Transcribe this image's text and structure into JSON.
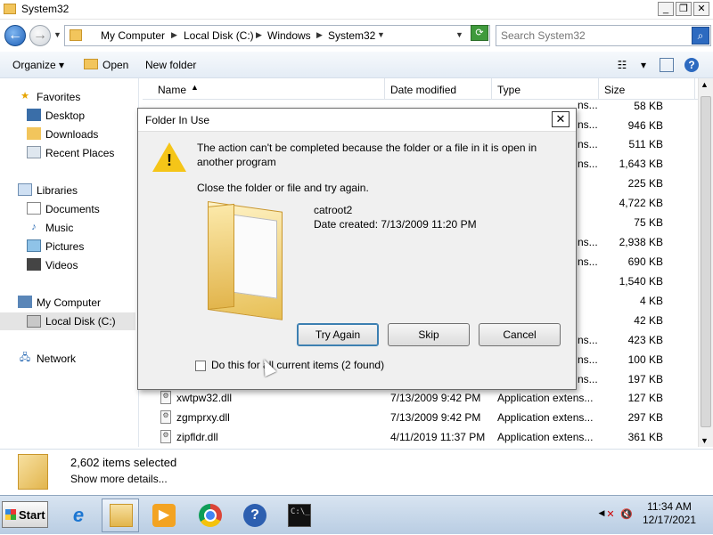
{
  "window": {
    "title": "System32"
  },
  "address": {
    "crumbs": [
      "My Computer",
      "Local Disk (C:)",
      "Windows",
      "System32"
    ],
    "search_placeholder": "Search System32"
  },
  "toolbar": {
    "organize": "Organize",
    "open": "Open",
    "new_folder": "New folder"
  },
  "nav": {
    "favorites": "Favorites",
    "desktop": "Desktop",
    "downloads": "Downloads",
    "recent": "Recent Places",
    "libraries": "Libraries",
    "documents": "Documents",
    "music": "Music",
    "pictures": "Pictures",
    "videos": "Videos",
    "computer": "My Computer",
    "localdisk": "Local Disk (C:)",
    "network": "Network"
  },
  "columns": {
    "name": "Name",
    "date": "Date modified",
    "type": "Type",
    "size": "Size"
  },
  "background_sizes": [
    "58 KB",
    "946 KB",
    "511 KB",
    "1,643 KB",
    "225 KB",
    "4,722 KB",
    "75 KB",
    "2,938 KB",
    "690 KB",
    "1,540 KB",
    "4 KB",
    "42 KB",
    "423 KB",
    "100 KB",
    "197 KB"
  ],
  "type_fragments": [
    "ns...",
    "ns...",
    "ns...",
    "ns...",
    "ns...",
    "ns...",
    "ns...",
    "ns...",
    "ns..."
  ],
  "rows": [
    {
      "name": "xwtpw32.dll",
      "date": "7/13/2009 9:42 PM",
      "type": "Application extens...",
      "size": "127 KB"
    },
    {
      "name": "zgmprxy.dll",
      "date": "7/13/2009 9:42 PM",
      "type": "Application extens...",
      "size": "297 KB"
    },
    {
      "name": "zipfldr.dll",
      "date": "4/11/2019 11:37 PM",
      "type": "Application extens...",
      "size": "361 KB"
    }
  ],
  "details": {
    "count": "2,602 items selected",
    "more": "Show more details..."
  },
  "dialog": {
    "title": "Folder In Use",
    "message": "The action can't be completed because the folder or a file in it is open in another program",
    "instruction": "Close the folder or file and try again.",
    "file_name": "catroot2",
    "file_date": "Date created: 7/13/2009 11:20 PM",
    "btn_try": "Try Again",
    "btn_skip": "Skip",
    "btn_cancel": "Cancel",
    "checkbox_label": "Do this for all current items (2 found)"
  },
  "taskbar": {
    "start": "Start",
    "time": "11:34 AM",
    "date": "12/17/2021",
    "cmd_glyph": "C:\\_"
  }
}
